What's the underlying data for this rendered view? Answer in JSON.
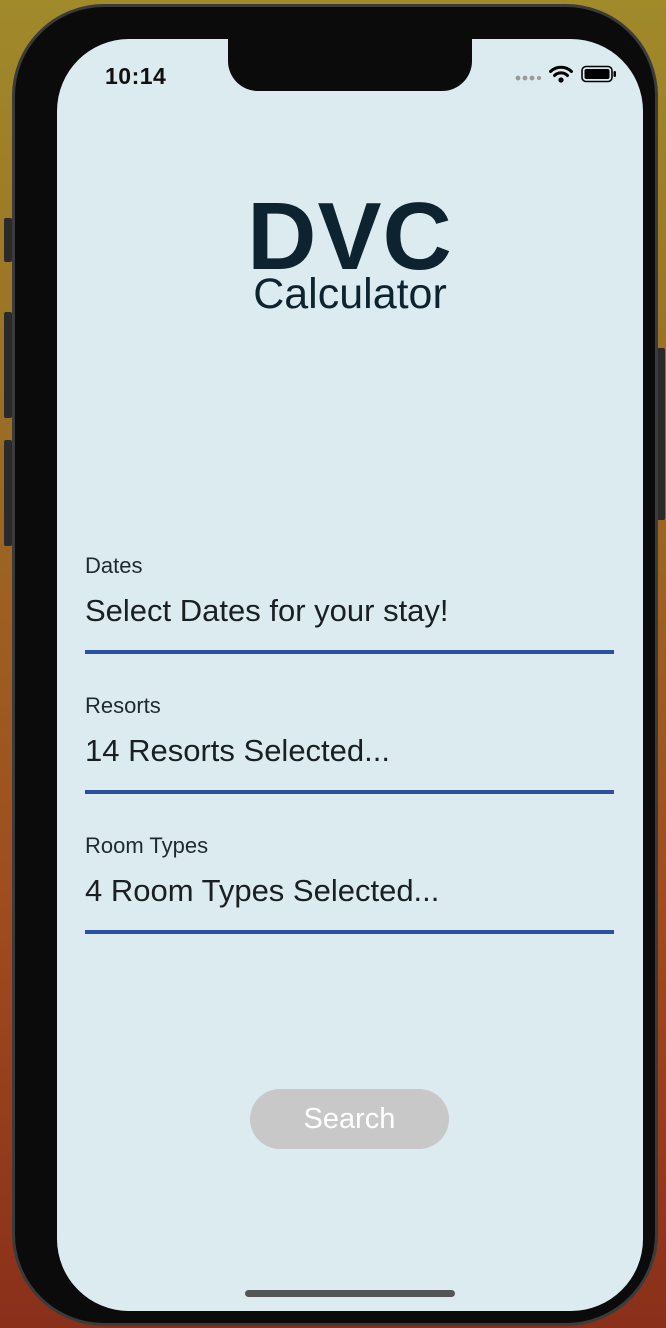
{
  "status_bar": {
    "time": "10:14",
    "icons": [
      "signal-dots-icon",
      "wifi-icon",
      "battery-icon"
    ]
  },
  "logo": {
    "title": "DVC",
    "subtitle": "Calculator"
  },
  "form": {
    "dates": {
      "label": "Dates",
      "value": "Select Dates for your stay!"
    },
    "resorts": {
      "label": "Resorts",
      "value": "14 Resorts Selected..."
    },
    "room_types": {
      "label": "Room Types",
      "value": "4 Room Types Selected..."
    }
  },
  "search_button": {
    "label": "Search"
  },
  "colors": {
    "screen_background": "#dbebf0",
    "accent_underline": "#2a4fa3",
    "logo_text": "#0d2430",
    "button_disabled": "#c8c8c8"
  }
}
